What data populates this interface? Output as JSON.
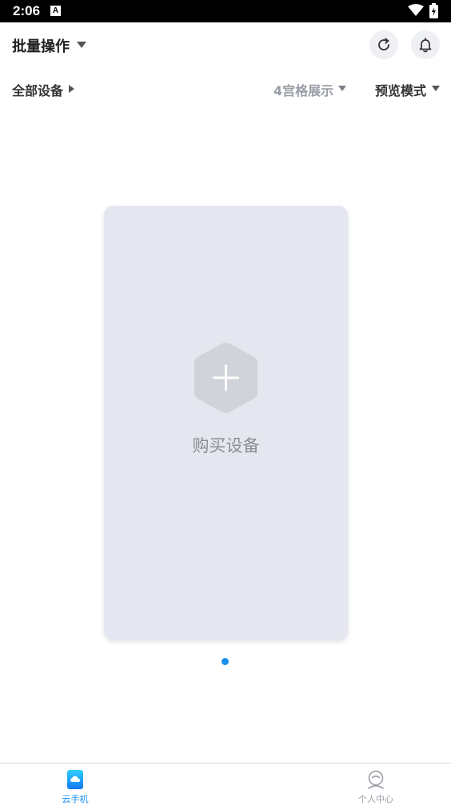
{
  "status_bar": {
    "time": "2:06",
    "notification_letter": "A"
  },
  "header": {
    "title": "批量操作"
  },
  "filters": {
    "all_devices": "全部设备",
    "grid_display": "4宫格展示",
    "preview_mode": "预览模式"
  },
  "card": {
    "buy_label": "购买设备"
  },
  "bottom_nav": {
    "items": [
      {
        "label": "云手机"
      },
      {
        "label": "个人中心"
      }
    ]
  },
  "colors": {
    "accent": "#1890f0",
    "card_bg": "#e4e7ef",
    "muted_text": "#9a9ea6"
  },
  "pager": {
    "total": 1,
    "current": 1
  }
}
